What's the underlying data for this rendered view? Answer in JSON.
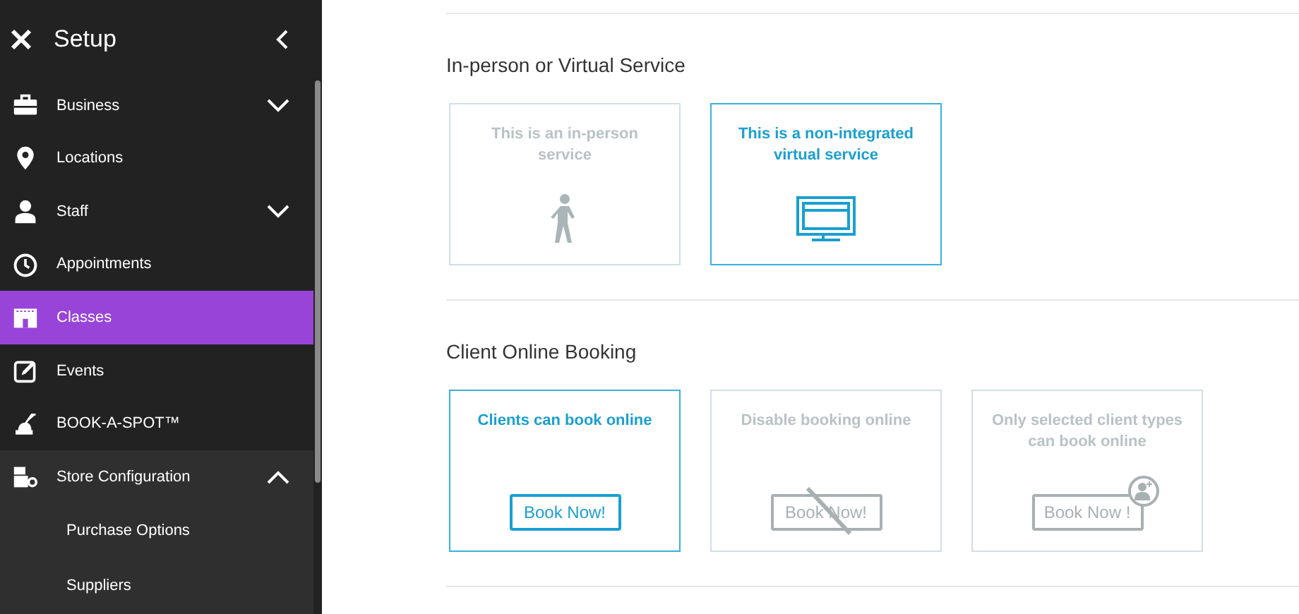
{
  "sidebar": {
    "title": "Setup",
    "items": [
      {
        "label": "Business",
        "selected": false,
        "expanded": false
      },
      {
        "label": "Locations",
        "selected": false
      },
      {
        "label": "Staff",
        "selected": false,
        "expanded": false
      },
      {
        "label": "Appointments",
        "selected": false
      },
      {
        "label": "Classes",
        "selected": true
      },
      {
        "label": "Events",
        "selected": false
      },
      {
        "label": "BOOK-A-SPOT™",
        "selected": false
      },
      {
        "label": "Store Configuration",
        "selected": false,
        "expanded": true,
        "children": [
          {
            "label": "Purchase Options"
          },
          {
            "label": "Suppliers"
          }
        ]
      }
    ]
  },
  "sections": [
    {
      "title": "In-person or Virtual Service",
      "options": [
        {
          "label": "This is an in-person service",
          "kind": "person",
          "selected": false
        },
        {
          "label": "This is a non-integrated virtual service",
          "kind": "monitor",
          "selected": true
        }
      ]
    },
    {
      "title": "Client Online Booking",
      "options": [
        {
          "label": "Clients can book online",
          "kind": "book",
          "button": "Book Now!",
          "selected": true
        },
        {
          "label": "Disable booking online",
          "kind": "book-disabled",
          "button": "Book Now!",
          "selected": false
        },
        {
          "label": "Only selected client types can book online",
          "kind": "book-client",
          "button": "Book Now !",
          "selected": false
        }
      ]
    }
  ]
}
